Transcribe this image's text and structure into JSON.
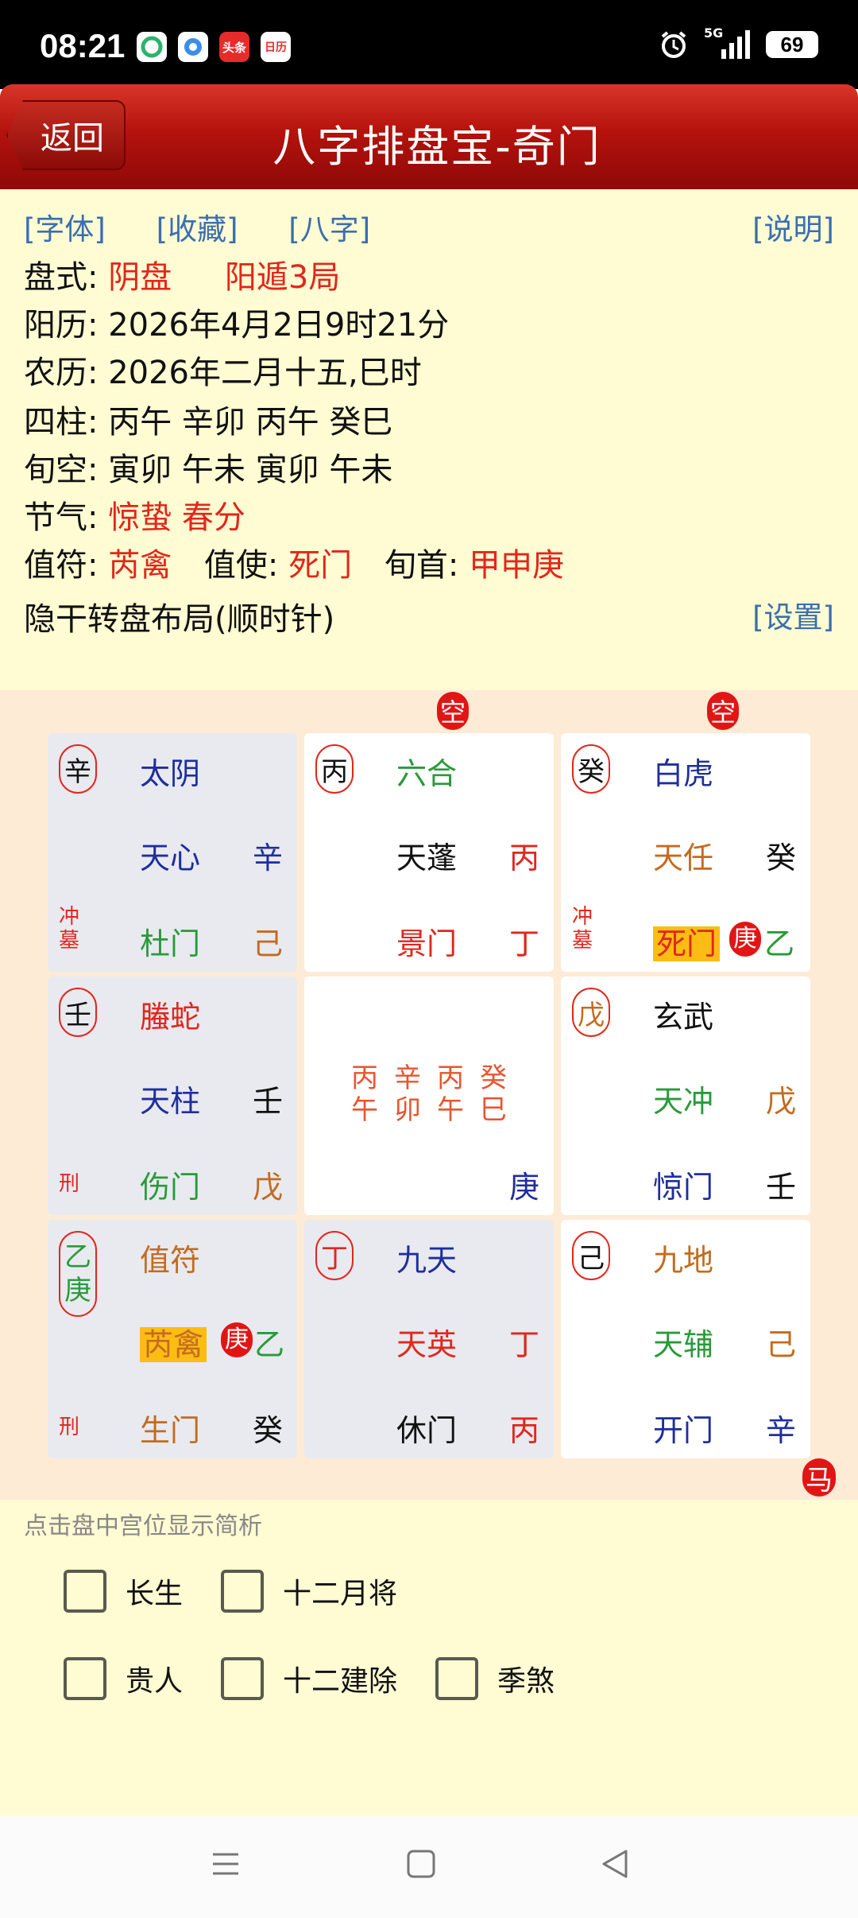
{
  "status_bar": {
    "time": "08:21",
    "apps": [
      "app-icon-1",
      "app-icon-2",
      "头条",
      "日历"
    ],
    "network": "5G",
    "battery": "69"
  },
  "header": {
    "back": "返回",
    "title": "八字排盘宝-奇门"
  },
  "info": {
    "links": [
      "[字体]",
      "[收藏]",
      "[八字]"
    ],
    "explain": "[说明]",
    "settings": "[设置]",
    "panshi_label": "盘式:",
    "panshi_val1": "阴盘",
    "panshi_val2": "阳遁3局",
    "solar": "阳历: 2026年4月2日9时21分",
    "lunar": "农历: 2026年二月十五,巳时",
    "sizhu": "四柱: 丙午  辛卯  丙午  癸巳",
    "xunkong": "旬空: 寅卯  午未  寅卯  午未",
    "jieqi_label": "节气:",
    "jieqi_val": "惊蛰 春分",
    "zhifu_label": "值符:",
    "zhifu_val": "芮禽",
    "zhishi_label": "值使:",
    "zhishi_val": "死门",
    "xunshou_label": "旬首:",
    "xunshou_val": "甲申庚",
    "layout": "隐干转盘布局(顺时针)"
  },
  "board": {
    "kong": "空",
    "ma": "马",
    "cells": {
      "nw": {
        "stem": "辛",
        "god": "太阴",
        "star": "天心",
        "star_stem": "辛",
        "door": "杜门",
        "door_stem": "己",
        "mark1": "冲",
        "mark2": "墓"
      },
      "n": {
        "stem": "丙",
        "god": "六合",
        "star": "天蓬",
        "star_stem": "丙",
        "door": "景门",
        "door_stem": "丁"
      },
      "ne": {
        "stem": "癸",
        "god": "白虎",
        "star": "天任",
        "star_stem": "癸",
        "door": "死门",
        "geng": "庚",
        "door_stem": "乙",
        "mark1": "冲",
        "mark2": "墓"
      },
      "w": {
        "stem": "壬",
        "god": "螣蛇",
        "star": "天柱",
        "star_stem": "壬",
        "door": "伤门",
        "door_stem": "戊",
        "mark1": "刑"
      },
      "c": {
        "pillars": [
          [
            "丙",
            "午"
          ],
          [
            "辛",
            "卯"
          ],
          [
            "丙",
            "午"
          ],
          [
            "癸",
            "巳"
          ]
        ],
        "stem": "庚"
      },
      "e": {
        "stem": "戊",
        "god": "玄武",
        "star": "天冲",
        "star_stem": "戊",
        "door": "惊门",
        "door_stem": "壬"
      },
      "sw": {
        "stem1": "乙",
        "stem2": "庚",
        "god": "值符",
        "star": "芮禽",
        "geng": "庚",
        "star_stem": "乙",
        "door": "生门",
        "door_stem": "癸",
        "mark1": "刑"
      },
      "s": {
        "stem": "丁",
        "god": "九天",
        "star": "天英",
        "star_stem": "丁",
        "door": "休门",
        "door_stem": "丙"
      },
      "se": {
        "stem": "己",
        "god": "九地",
        "star": "天辅",
        "star_stem": "己",
        "door": "开门",
        "door_stem": "辛"
      }
    }
  },
  "options": {
    "hint": "点击盘中宫位显示简析",
    "items": [
      "长生",
      "十二月将",
      "贵人",
      "十二建除",
      "季煞"
    ]
  },
  "colors": {
    "header_red": "#b5120d",
    "info_bg": "#fffbd2",
    "board_bg": "#fdebd6",
    "highlight": "#fbbc14",
    "red_badge": "#e21515"
  }
}
